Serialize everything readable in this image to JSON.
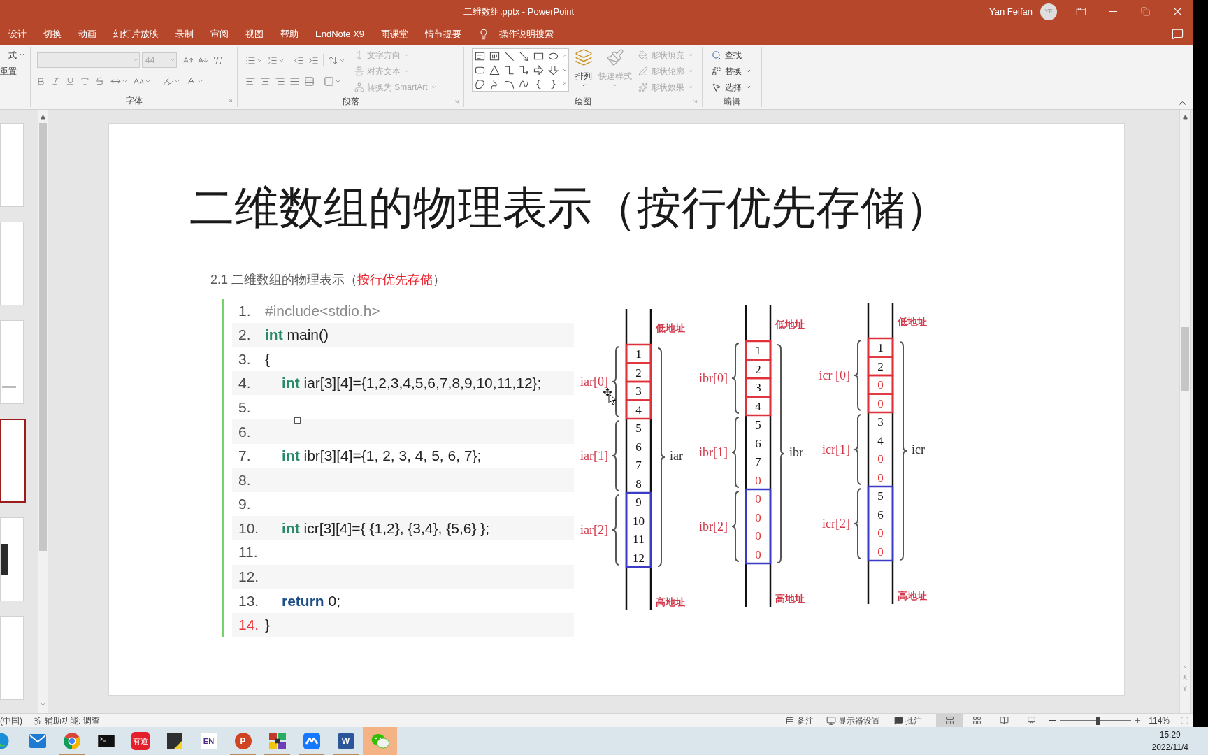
{
  "window": {
    "title": "二维数组.pptx - PowerPoint",
    "user": "Yan Feifan",
    "avatar_initials": "YF"
  },
  "tabs": [
    {
      "label": "设计",
      "selected": false
    },
    {
      "label": "切换",
      "selected": false
    },
    {
      "label": "动画",
      "selected": false
    },
    {
      "label": "幻灯片放映",
      "selected": false
    },
    {
      "label": "录制",
      "selected": false
    },
    {
      "label": "审阅",
      "selected": false
    },
    {
      "label": "视图",
      "selected": false
    },
    {
      "label": "帮助",
      "selected": false
    },
    {
      "label": "EndNote X9",
      "selected": false
    },
    {
      "label": "雨课堂",
      "selected": false
    },
    {
      "label": "情节提要",
      "selected": false
    }
  ],
  "tell_me": {
    "label": "操作说明搜索"
  },
  "ribbon": {
    "clipped_group": {
      "items": [
        {
          "label": "式",
          "dropdown": true
        },
        {
          "label": "重置",
          "dropdown": false
        }
      ]
    },
    "font_group": {
      "label": "字体",
      "font_size": {
        "value": "44",
        "disabled": true
      }
    },
    "paragraph_group": {
      "label": "段落",
      "commands": [
        {
          "label": "文字方向",
          "disabled": true,
          "dropdown": true
        },
        {
          "label": "对齐文本",
          "disabled": true,
          "dropdown": true
        },
        {
          "label": "转换为 SmartArt",
          "disabled": true,
          "dropdown": true
        }
      ]
    },
    "drawing_group": {
      "label": "绘图",
      "arrange": {
        "label": "排列",
        "disabled": false
      },
      "quick_styles": {
        "label": "快速样式",
        "disabled": true
      },
      "commands": [
        {
          "label": "形状填充",
          "disabled": true,
          "dropdown": true
        },
        {
          "label": "形状轮廓",
          "disabled": true,
          "dropdown": true
        },
        {
          "label": "形状效果",
          "disabled": true,
          "dropdown": true
        }
      ]
    },
    "editing_group": {
      "label": "编辑",
      "commands": [
        {
          "label": "查找",
          "disabled": false,
          "dropdown": false
        },
        {
          "label": "替换",
          "disabled": false,
          "dropdown": true
        },
        {
          "label": "选择",
          "disabled": false,
          "dropdown": true
        }
      ]
    }
  },
  "thumbnails": [
    {
      "kind": "blank",
      "selected": false
    },
    {
      "kind": "blank",
      "selected": false
    },
    {
      "kind": "text",
      "selected": false
    },
    {
      "kind": "blank",
      "selected": true
    },
    {
      "kind": "image",
      "selected": false
    },
    {
      "kind": "blank",
      "selected": false
    }
  ],
  "slide": {
    "title": "二维数组的物理表示（按行优先存储）",
    "subtitle": [
      {
        "text": "2.1 二维数组的物理表示（",
        "emphasis": false
      },
      {
        "text": "按行优先存储",
        "emphasis": true
      },
      {
        "text": "）",
        "emphasis": false
      }
    ],
    "code": {
      "lines": [
        {
          "number": "1.",
          "current": false,
          "tokens": [
            {
              "kind": "directive",
              "text": "#include<stdio.h>"
            }
          ]
        },
        {
          "number": "2.",
          "current": false,
          "tokens": [
            {
              "kind": "type",
              "text": "int"
            },
            {
              "kind": "plain",
              "text": " main()"
            }
          ]
        },
        {
          "number": "3.",
          "current": false,
          "tokens": [
            {
              "kind": "plain",
              "text": "{"
            }
          ],
          "children": [
            {
              "number": "4.",
              "current": false,
              "tokens": [
                {
                  "kind": "type",
                  "text": "int"
                },
                {
                  "kind": "plain",
                  "text": " iar[3][4]={1,2,3,4,5,6,7,8,9,10,11,12};"
                }
              ]
            },
            {
              "number": "5.",
              "current": false
            },
            {
              "number": "6.",
              "current": false
            },
            {
              "number": "7.",
              "current": false,
              "tokens": [
                {
                  "kind": "type",
                  "text": "int"
                },
                {
                  "kind": "plain",
                  "text": " ibr[3][4]={1, 2, 3, 4, 5, 6, 7};"
                }
              ]
            },
            {
              "number": "8.",
              "current": false
            },
            {
              "number": "9.",
              "current": false
            },
            {
              "number": "10.",
              "current": false,
              "tokens": [
                {
                  "kind": "type",
                  "text": "int"
                },
                {
                  "kind": "plain",
                  "text": " icr[3][4]={ {1,2}, {3,4}, {5,6} };"
                }
              ]
            },
            {
              "number": "11.",
              "current": false
            },
            {
              "number": "12.",
              "current": false
            },
            {
              "number": "13.",
              "current": false,
              "tokens": [
                {
                  "kind": "keyword",
                  "text": "return"
                },
                {
                  "kind": "plain",
                  "text": " 0;"
                }
              ]
            }
          ]
        },
        {
          "number": "14.",
          "current": true,
          "tokens": [
            {
              "kind": "plain",
              "text": "}"
            }
          ]
        }
      ]
    },
    "diagram": {
      "columns": [
        {
          "name": "iar",
          "low_label": "低地址",
          "high_label": "高地址",
          "rows": [
            {
              "label": "iar[0]",
              "kind": "cells",
              "cells": [
                {
                  "value": "1",
                  "implicit": false
                },
                {
                  "value": "2",
                  "implicit": false
                },
                {
                  "value": "3",
                  "implicit": false
                },
                {
                  "value": "4",
                  "implicit": false
                }
              ]
            },
            {
              "label": "iar[1]",
              "kind": "plain",
              "cells": [
                {
                  "value": "5",
                  "implicit": false
                },
                {
                  "value": "6",
                  "implicit": false
                },
                {
                  "value": "7",
                  "implicit": false
                },
                {
                  "value": "8",
                  "implicit": false
                }
              ]
            },
            {
              "label": "iar[2]",
              "kind": "block",
              "cells": [
                {
                  "value": "9",
                  "implicit": false
                },
                {
                  "value": "10",
                  "implicit": false
                },
                {
                  "value": "11",
                  "implicit": false
                },
                {
                  "value": "12",
                  "implicit": false
                }
              ]
            }
          ]
        },
        {
          "name": "ibr",
          "low_label": "低地址",
          "high_label": "高地址",
          "rows": [
            {
              "label": "ibr[0]",
              "kind": "cells",
              "cells": [
                {
                  "value": "1",
                  "implicit": false
                },
                {
                  "value": "2",
                  "implicit": false
                },
                {
                  "value": "3",
                  "implicit": false
                },
                {
                  "value": "4",
                  "implicit": false
                }
              ]
            },
            {
              "label": "ibr[1]",
              "kind": "plain",
              "cells": [
                {
                  "value": "5",
                  "implicit": false
                },
                {
                  "value": "6",
                  "implicit": false
                },
                {
                  "value": "7",
                  "implicit": false
                },
                {
                  "value": "0",
                  "implicit": true
                }
              ]
            },
            {
              "label": "ibr[2]",
              "kind": "block",
              "cells": [
                {
                  "value": "0",
                  "implicit": true
                },
                {
                  "value": "0",
                  "implicit": true
                },
                {
                  "value": "0",
                  "implicit": true
                },
                {
                  "value": "0",
                  "implicit": true
                }
              ]
            }
          ]
        },
        {
          "name": "icr",
          "low_label": "低地址",
          "high_label": "高地址",
          "rows": [
            {
              "label": "icr [0]",
              "kind": "cells",
              "cells": [
                {
                  "value": "1",
                  "implicit": false
                },
                {
                  "value": "2",
                  "implicit": false
                },
                {
                  "value": "0",
                  "implicit": true
                },
                {
                  "value": "0",
                  "implicit": true
                }
              ]
            },
            {
              "label": "icr[1]",
              "kind": "plain",
              "cells": [
                {
                  "value": "3",
                  "implicit": false
                },
                {
                  "value": "4",
                  "implicit": false
                },
                {
                  "value": "0",
                  "implicit": true
                },
                {
                  "value": "0",
                  "implicit": true
                }
              ]
            },
            {
              "label": "icr[2]",
              "kind": "block",
              "cells": [
                {
                  "value": "5",
                  "implicit": false
                },
                {
                  "value": "6",
                  "implicit": false
                },
                {
                  "value": "0",
                  "implicit": true
                },
                {
                  "value": "0",
                  "implicit": true
                }
              ]
            }
          ]
        }
      ]
    }
  },
  "status_bar": {
    "language": "(中国)",
    "accessibility": "辅助功能: 调查",
    "notes": "备注",
    "display_settings": "显示器设置",
    "comments": "批注",
    "views": [
      {
        "kind": "normal",
        "selected": true
      },
      {
        "kind": "sorter",
        "selected": false
      },
      {
        "kind": "reading",
        "selected": false
      },
      {
        "kind": "slideshow",
        "selected": false
      }
    ],
    "zoom": {
      "level": 0.52,
      "reading": "114%"
    }
  },
  "taskbar": {
    "apps": [
      {
        "kind": "edge",
        "running": false,
        "flashing": false
      },
      {
        "kind": "mail",
        "running": false,
        "flashing": false
      },
      {
        "kind": "chrome",
        "running": true,
        "flashing": false
      },
      {
        "kind": "terminal",
        "running": false,
        "flashing": false
      },
      {
        "kind": "youdao",
        "glyph": "有道",
        "running": false,
        "flashing": false
      },
      {
        "kind": "notes",
        "running": false,
        "flashing": false
      },
      {
        "kind": "endnote",
        "glyph": "EN",
        "running": false,
        "flashing": false
      },
      {
        "kind": "powerpoint",
        "glyph": "P",
        "running": true,
        "flashing": false
      },
      {
        "kind": "blocks",
        "running": true,
        "flashing": false
      },
      {
        "kind": "cloud",
        "running": true,
        "flashing": false
      },
      {
        "kind": "word",
        "glyph": "W",
        "running": true,
        "flashing": false
      },
      {
        "kind": "wechat",
        "running": false,
        "flashing": true
      }
    ],
    "time": "15:29",
    "date": "2022/11/4"
  }
}
